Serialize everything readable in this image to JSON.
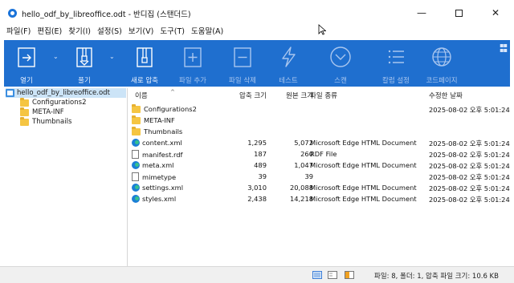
{
  "window": {
    "title": "hello_odf_by_libreoffice.odt - 반디집 (스탠더드)",
    "minimize_glyph": "—",
    "close_glyph": "✕"
  },
  "menu": [
    {
      "label": "파일(F)"
    },
    {
      "label": "편집(E)"
    },
    {
      "label": "찾기(I)"
    },
    {
      "label": "설정(S)"
    },
    {
      "label": "보기(V)"
    },
    {
      "label": "도구(T)"
    },
    {
      "label": "도움말(A)"
    }
  ],
  "toolbar": {
    "open": "열기",
    "extract": "풀기",
    "new_archive": "새로 압축",
    "add_files": "파일 추가",
    "delete_files": "파일 삭제",
    "test": "테스트",
    "scan": "스캔",
    "columns": "칼럼 설정",
    "codepage": "코드페이지",
    "accent_color": "#1f6fcf"
  },
  "tree": {
    "root": "hello_odf_by_libreoffice.odt",
    "children": [
      "Configurations2",
      "META-INF",
      "Thumbnails"
    ]
  },
  "list": {
    "headers": {
      "name": "이름",
      "compressed": "압축 크기",
      "original": "원본 크기",
      "type": "파일 종류",
      "modified": "수정한 날짜"
    },
    "rows": [
      {
        "icon": "folder-icon",
        "name": "Configurations2",
        "compressed": "",
        "original": "",
        "type": "",
        "modified": "2025-08-02 오후 5:01:24"
      },
      {
        "icon": "folder-icon",
        "name": "META-INF",
        "compressed": "",
        "original": "",
        "type": "",
        "modified": ""
      },
      {
        "icon": "folder-icon",
        "name": "Thumbnails",
        "compressed": "",
        "original": "",
        "type": "",
        "modified": ""
      },
      {
        "icon": "edge-icon",
        "name": "content.xml",
        "compressed": "1,295",
        "original": "5,072",
        "type": "Microsoft Edge HTML Document",
        "modified": "2025-08-02 오후 5:01:24"
      },
      {
        "icon": "file-icon",
        "name": "manifest.rdf",
        "compressed": "187",
        "original": "260",
        "type": "RDF File",
        "modified": "2025-08-02 오후 5:01:24"
      },
      {
        "icon": "edge-icon",
        "name": "meta.xml",
        "compressed": "489",
        "original": "1,047",
        "type": "Microsoft Edge HTML Document",
        "modified": "2025-08-02 오후 5:01:24"
      },
      {
        "icon": "file-icon",
        "name": "mimetype",
        "compressed": "39",
        "original": "39",
        "type": "",
        "modified": "2025-08-02 오후 5:01:24"
      },
      {
        "icon": "edge-icon",
        "name": "settings.xml",
        "compressed": "3,010",
        "original": "20,088",
        "type": "Microsoft Edge HTML Document",
        "modified": "2025-08-02 오후 5:01:24"
      },
      {
        "icon": "edge-icon",
        "name": "styles.xml",
        "compressed": "2,438",
        "original": "14,218",
        "type": "Microsoft Edge HTML Document",
        "modified": "2025-08-02 오후 5:01:24"
      }
    ]
  },
  "status": {
    "summary": "파일: 8, 폴더: 1, 압축 파일 크기: 10.6 KB"
  }
}
